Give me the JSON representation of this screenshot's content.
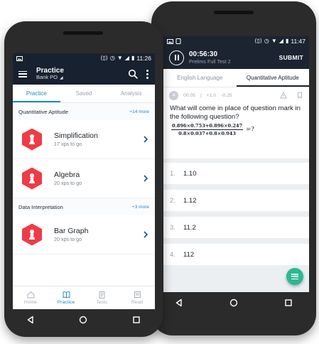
{
  "accent_colors": {
    "header": "#17212f",
    "accent": "#1e88c9",
    "hex_icon": "#ef3b47",
    "fab": "#2aba8f"
  },
  "front_phone": {
    "status": {
      "time": "11:26"
    },
    "header": {
      "title": "Practice",
      "subtitle": "Bank PO"
    },
    "tabs": [
      {
        "label": "Practice"
      },
      {
        "label": "Saved"
      },
      {
        "label": "Analysis"
      }
    ],
    "sections": [
      {
        "title": "Quantitative Aptitude",
        "more": "+14 more",
        "topics": [
          {
            "name": "Simplification",
            "xps": "17 xps to go",
            "icon": "pawn-icon"
          },
          {
            "name": "Algebra",
            "xps": "20 xps to go",
            "icon": "pawn-icon"
          }
        ]
      },
      {
        "title": "Data Interpretation",
        "more": "+3 more",
        "topics": [
          {
            "name": "Bar Graph",
            "xps": "20 xps to go",
            "icon": "pawn-icon"
          }
        ]
      }
    ],
    "bottom_nav": [
      {
        "label": "Home"
      },
      {
        "label": "Practice"
      },
      {
        "label": "Tests"
      },
      {
        "label": "Read"
      }
    ]
  },
  "back_phone": {
    "status": {
      "time": "11:47"
    },
    "header": {
      "timer": "00:56:30",
      "test_name": "Prelims Full Test 2",
      "submit": "SUBMIT"
    },
    "section_tabs": [
      {
        "label": "English Language"
      },
      {
        "label": "Quantitative Aptitude"
      }
    ],
    "question": {
      "number": "4",
      "time": "00:05",
      "positive": "+1.0",
      "negative": "-0.25",
      "text": "What will come in place of question mark in the following question?",
      "numerator": "0.896×0.753+0.896×0.247",
      "denominator": "0.8×0.037+0.8×0.943",
      "equals": "=?"
    },
    "options": [
      {
        "no": "1.",
        "value": "1.10"
      },
      {
        "no": "2.",
        "value": "1.12"
      },
      {
        "no": "3.",
        "value": "11.2"
      },
      {
        "no": "4.",
        "value": "112"
      }
    ]
  }
}
